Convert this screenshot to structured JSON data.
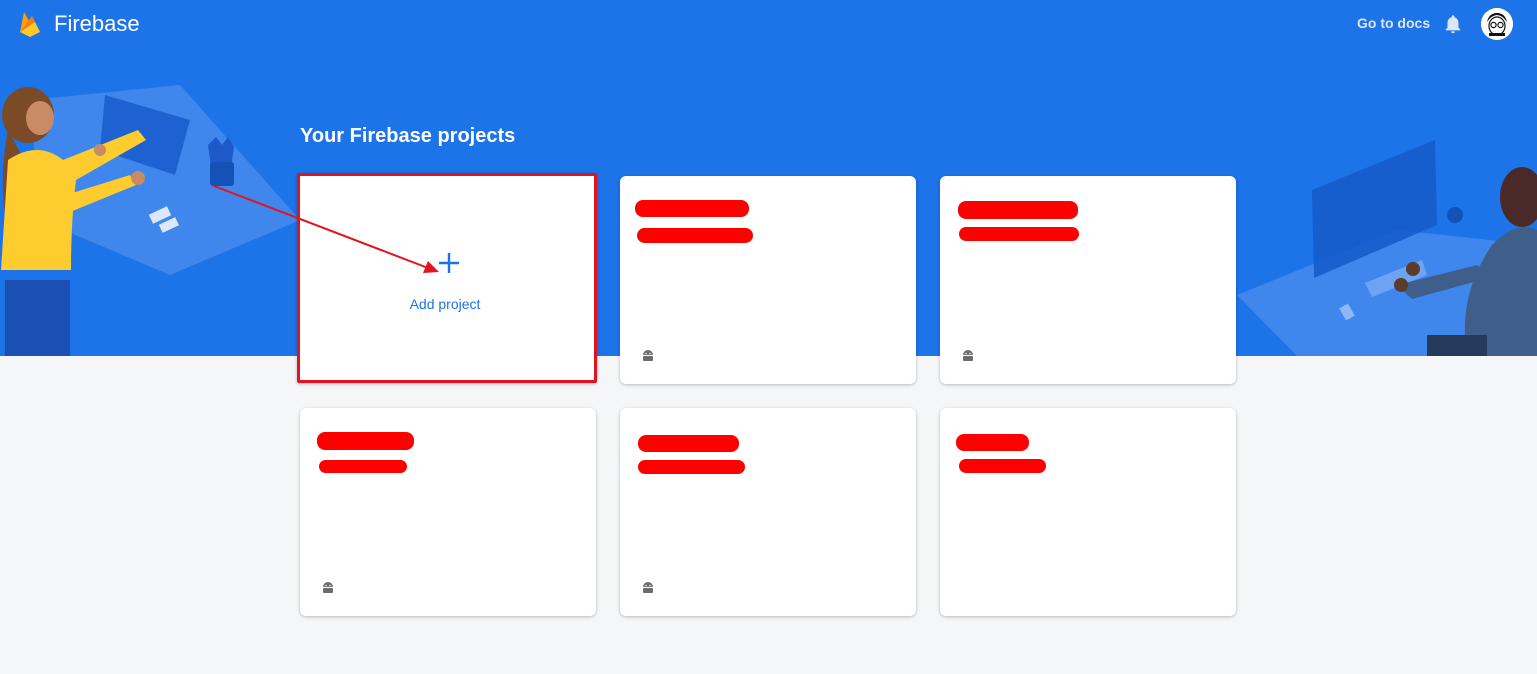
{
  "header": {
    "brand": "Firebase",
    "docs_link": "Go to docs"
  },
  "main": {
    "title": "Your Firebase projects",
    "add_project_label": "Add project",
    "projects": [
      {
        "platform_icon": "android-icon",
        "name": "",
        "id": ""
      },
      {
        "platform_icon": "android-icon",
        "name": "",
        "id": ""
      },
      {
        "platform_icon": "android-icon",
        "name": "",
        "id": ""
      },
      {
        "platform_icon": "android-icon",
        "name": "",
        "id": ""
      },
      {
        "platform_icon": "",
        "name": "",
        "id": ""
      }
    ]
  },
  "colors": {
    "brand_blue": "#1d73e8",
    "link_blue": "#1a73e8",
    "annotation_red": "#e0141e",
    "background": "#f5f6f8"
  }
}
